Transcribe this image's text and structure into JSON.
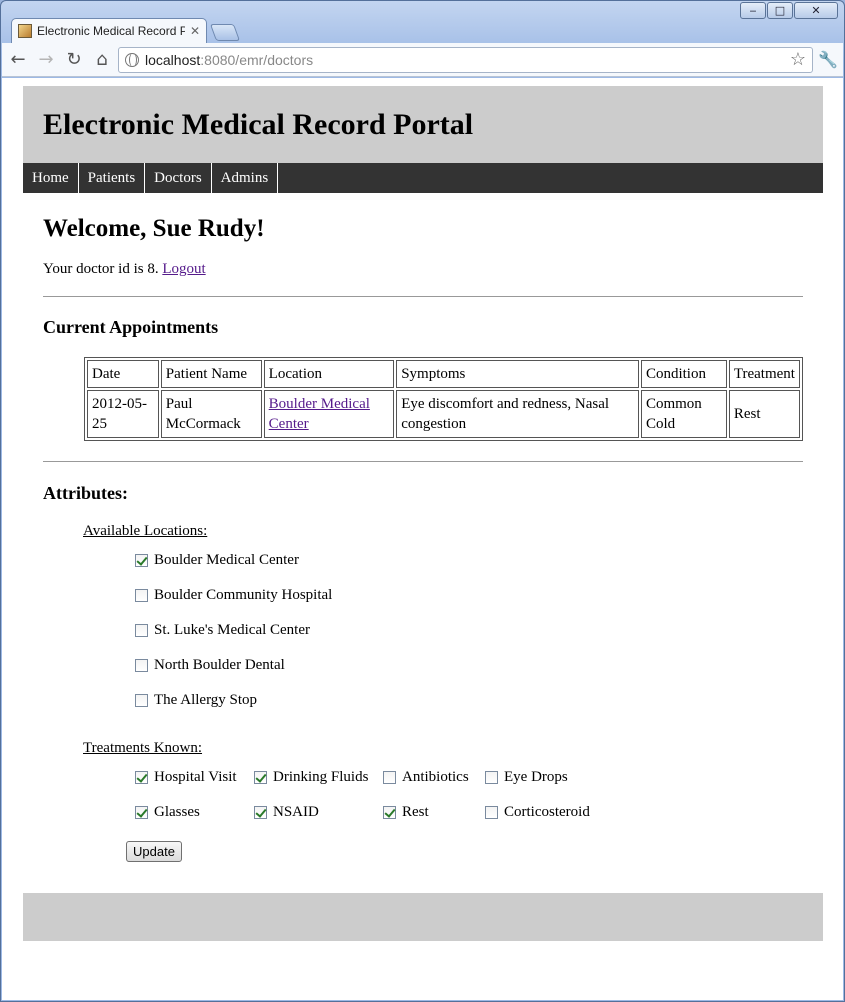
{
  "window": {
    "minimize_glyph": "‒",
    "maximize_glyph": "□",
    "close_glyph": "✕"
  },
  "tab": {
    "title": "Electronic Medical Record Port",
    "close_glyph": "✕"
  },
  "toolbar": {
    "back_glyph": "←",
    "forward_glyph": "→",
    "reload_glyph": "↻",
    "home_glyph": "⌂",
    "url_host": "localhost",
    "url_rest": ":8080/emr/doctors",
    "star_glyph": "☆",
    "wrench_glyph": "🔧"
  },
  "page": {
    "title": "Electronic Medical Record Portal",
    "nav": [
      "Home",
      "Patients",
      "Doctors",
      "Admins"
    ],
    "welcome": "Welcome, Sue Rudy!",
    "doctor_id_text": "Your doctor id is 8.",
    "logout": "Logout",
    "current_appointments": "Current Appointments",
    "table": {
      "headers": [
        "Date",
        "Patient Name",
        "Location",
        "Symptoms",
        "Condition",
        "Treatment"
      ],
      "rows": [
        {
          "date": "2012-05-25",
          "patient": "Paul McCormack",
          "location": "Boulder Medical Center",
          "symptoms": "Eye discomfort and redness, Nasal congestion",
          "condition": "Common Cold",
          "treatment": "Rest"
        }
      ]
    },
    "attributes_heading": "Attributes:",
    "available_locations_label": "Available Locations:",
    "locations": [
      {
        "label": "Boulder Medical Center",
        "checked": true
      },
      {
        "label": "Boulder Community Hospital",
        "checked": false
      },
      {
        "label": "St. Luke's Medical Center",
        "checked": false
      },
      {
        "label": "North Boulder Dental",
        "checked": false
      },
      {
        "label": "The Allergy Stop",
        "checked": false
      }
    ],
    "treatments_known_label": "Treatments Known:",
    "treatments": [
      {
        "label": "Hospital Visit",
        "checked": true
      },
      {
        "label": "Drinking Fluids",
        "checked": true
      },
      {
        "label": "Antibiotics",
        "checked": false
      },
      {
        "label": "Eye Drops",
        "checked": false
      },
      {
        "label": "Glasses",
        "checked": true
      },
      {
        "label": "NSAID",
        "checked": true
      },
      {
        "label": "Rest",
        "checked": true
      },
      {
        "label": "Corticosteroid",
        "checked": false
      }
    ],
    "update_button": "Update"
  }
}
